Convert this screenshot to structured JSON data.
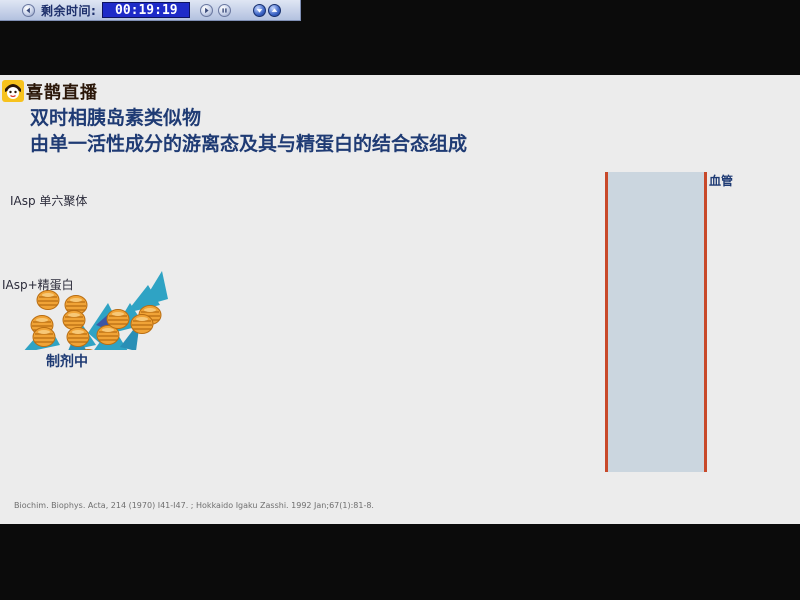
{
  "player": {
    "remaining_label": "剩余时间:",
    "timer": "00:19:19",
    "icons": {
      "back": "rewind-icon",
      "pause": "pause-icon",
      "play": "play-icon",
      "stop": "stop-icon",
      "down": "chevron-down-icon",
      "up": "chevron-up-icon"
    }
  },
  "slide": {
    "logo_text": "喜鹊直播",
    "title_line1": "双时相胰岛素类似物",
    "title_line2": "由单一活性成分的游离态及其与精蛋白的结合态组成",
    "label_hexamer": "IAsp 单六聚体",
    "label_protamine": "IAsp+精蛋白",
    "label_preparation": "制剂中",
    "label_vessel": "血管",
    "citation": "Biochim. Biophys. Acta, 214 (1970) I41-I47. ; Hokkaido Igaku Zasshi. 1992 Jan;67(1):81-8.",
    "colors": {
      "title": "#1f3b74",
      "hexamer": "#f0a336",
      "protamine": "#2fa3c4",
      "vessel_fill": "#cbd6df",
      "vessel_wall": "#c8492a"
    }
  }
}
